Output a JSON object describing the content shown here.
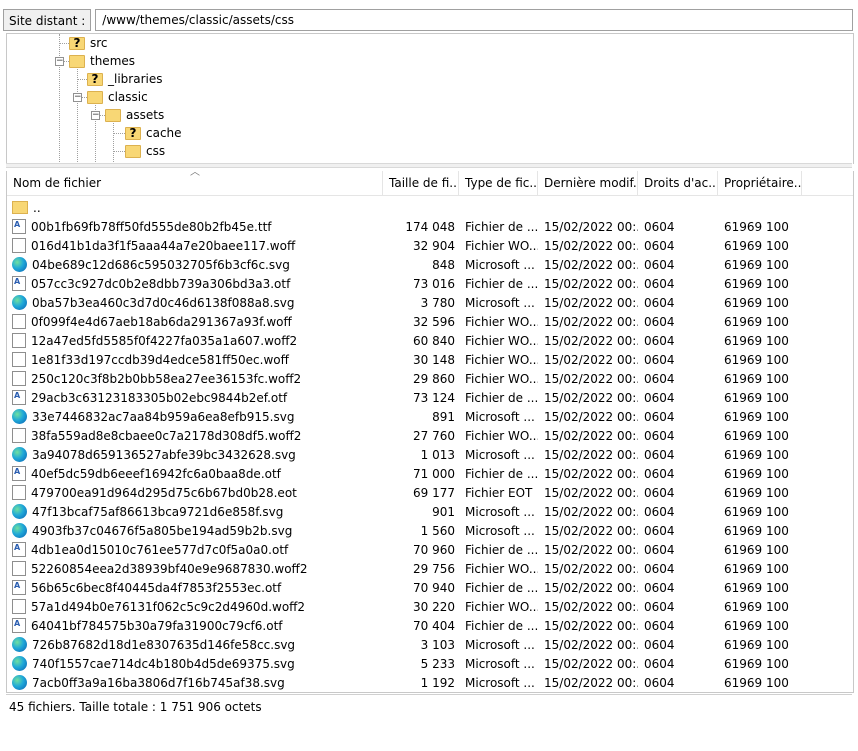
{
  "remote_site": {
    "label": "Site distant :",
    "path": "/www/themes/classic/assets/css"
  },
  "tree": {
    "items": [
      {
        "label": "src",
        "icon": "unknown-folder-icon"
      },
      {
        "label": "themes",
        "icon": "folder-icon"
      },
      {
        "label": "_libraries",
        "icon": "unknown-folder-icon"
      },
      {
        "label": "classic",
        "icon": "folder-icon"
      },
      {
        "label": "assets",
        "icon": "folder-icon"
      },
      {
        "label": "cache",
        "icon": "unknown-folder-icon"
      },
      {
        "label": "css",
        "icon": "folder-icon"
      }
    ]
  },
  "columns": {
    "name": "Nom de fichier",
    "size": "Taille de fi...",
    "type": "Type de fic...",
    "date": "Dernière modif...",
    "perm": "Droits d'ac...",
    "owner": "Propriétaire..."
  },
  "parent_row": {
    "name": ".."
  },
  "files": [
    {
      "name": "00b1fb69fb78ff50fd555de80b2fb45e.ttf",
      "size": "174 048",
      "type": "Fichier de ...",
      "date": "15/02/2022 00:...",
      "perm": "0604",
      "owner": "61969 100",
      "icon": "font-file-icon"
    },
    {
      "name": "016d41b1da3f1f5aaa44a7e20baee117.woff",
      "size": "32 904",
      "type": "Fichier WO...",
      "date": "15/02/2022 00:...",
      "perm": "0604",
      "owner": "61969 100",
      "icon": "file-icon"
    },
    {
      "name": "04be689c12d686c595032705f6b3cf6c.svg",
      "size": "848",
      "type": "Microsoft ...",
      "date": "15/02/2022 00:...",
      "perm": "0604",
      "owner": "61969 100",
      "icon": "edge-icon"
    },
    {
      "name": "057cc3c927dc0b2e8dbb739a306bd3a3.otf",
      "size": "73 016",
      "type": "Fichier de ...",
      "date": "15/02/2022 00:...",
      "perm": "0604",
      "owner": "61969 100",
      "icon": "font-file-icon"
    },
    {
      "name": "0ba57b3ea460c3d7d0c46d6138f088a8.svg",
      "size": "3 780",
      "type": "Microsoft ...",
      "date": "15/02/2022 00:...",
      "perm": "0604",
      "owner": "61969 100",
      "icon": "edge-icon"
    },
    {
      "name": "0f099f4e4d67aeb18ab6da291367a93f.woff",
      "size": "32 596",
      "type": "Fichier WO...",
      "date": "15/02/2022 00:...",
      "perm": "0604",
      "owner": "61969 100",
      "icon": "file-icon"
    },
    {
      "name": "12a47ed5fd5585f0f4227fa035a1a607.woff2",
      "size": "60 840",
      "type": "Fichier WO...",
      "date": "15/02/2022 00:...",
      "perm": "0604",
      "owner": "61969 100",
      "icon": "file-icon"
    },
    {
      "name": "1e81f33d197ccdb39d4edce581ff50ec.woff",
      "size": "30 148",
      "type": "Fichier WO...",
      "date": "15/02/2022 00:...",
      "perm": "0604",
      "owner": "61969 100",
      "icon": "file-icon"
    },
    {
      "name": "250c120c3f8b2b0bb58ea27ee36153fc.woff2",
      "size": "29 860",
      "type": "Fichier WO...",
      "date": "15/02/2022 00:...",
      "perm": "0604",
      "owner": "61969 100",
      "icon": "file-icon"
    },
    {
      "name": "29acb3c63123183305b02ebc9844b2ef.otf",
      "size": "73 124",
      "type": "Fichier de ...",
      "date": "15/02/2022 00:...",
      "perm": "0604",
      "owner": "61969 100",
      "icon": "font-file-icon"
    },
    {
      "name": "33e7446832ac7aa84b959a6ea8efb915.svg",
      "size": "891",
      "type": "Microsoft ...",
      "date": "15/02/2022 00:...",
      "perm": "0604",
      "owner": "61969 100",
      "icon": "edge-icon"
    },
    {
      "name": "38fa559ad8e8cbaee0c7a2178d308df5.woff2",
      "size": "27 760",
      "type": "Fichier WO...",
      "date": "15/02/2022 00:...",
      "perm": "0604",
      "owner": "61969 100",
      "icon": "file-icon"
    },
    {
      "name": "3a94078d659136527abfe39bc3432628.svg",
      "size": "1 013",
      "type": "Microsoft ...",
      "date": "15/02/2022 00:...",
      "perm": "0604",
      "owner": "61969 100",
      "icon": "edge-icon"
    },
    {
      "name": "40ef5dc59db6eeef16942fc6a0baa8de.otf",
      "size": "71 000",
      "type": "Fichier de ...",
      "date": "15/02/2022 00:...",
      "perm": "0604",
      "owner": "61969 100",
      "icon": "font-file-icon"
    },
    {
      "name": "479700ea91d964d295d75c6b67bd0b28.eot",
      "size": "69 177",
      "type": "Fichier EOT",
      "date": "15/02/2022 00:...",
      "perm": "0604",
      "owner": "61969 100",
      "icon": "file-icon"
    },
    {
      "name": "47f13bcaf75af86613bca9721d6e858f.svg",
      "size": "901",
      "type": "Microsoft ...",
      "date": "15/02/2022 00:...",
      "perm": "0604",
      "owner": "61969 100",
      "icon": "edge-icon"
    },
    {
      "name": "4903fb37c04676f5a805be194ad59b2b.svg",
      "size": "1 560",
      "type": "Microsoft ...",
      "date": "15/02/2022 00:...",
      "perm": "0604",
      "owner": "61969 100",
      "icon": "edge-icon"
    },
    {
      "name": "4db1ea0d15010c761ee577d7c0f5a0a0.otf",
      "size": "70 960",
      "type": "Fichier de ...",
      "date": "15/02/2022 00:...",
      "perm": "0604",
      "owner": "61969 100",
      "icon": "font-file-icon"
    },
    {
      "name": "52260854eea2d38939bf40e9e9687830.woff2",
      "size": "29 756",
      "type": "Fichier WO...",
      "date": "15/02/2022 00:...",
      "perm": "0604",
      "owner": "61969 100",
      "icon": "file-icon"
    },
    {
      "name": "56b65c6bec8f40445da4f7853f2553ec.otf",
      "size": "70 940",
      "type": "Fichier de ...",
      "date": "15/02/2022 00:...",
      "perm": "0604",
      "owner": "61969 100",
      "icon": "font-file-icon"
    },
    {
      "name": "57a1d494b0e76131f062c5c9c2d4960d.woff2",
      "size": "30 220",
      "type": "Fichier WO...",
      "date": "15/02/2022 00:...",
      "perm": "0604",
      "owner": "61969 100",
      "icon": "file-icon"
    },
    {
      "name": "64041bf784575b30a79fa31900c79cf6.otf",
      "size": "70 404",
      "type": "Fichier de ...",
      "date": "15/02/2022 00:...",
      "perm": "0604",
      "owner": "61969 100",
      "icon": "font-file-icon"
    },
    {
      "name": "726b87682d18d1e8307635d146fe58cc.svg",
      "size": "3 103",
      "type": "Microsoft ...",
      "date": "15/02/2022 00:...",
      "perm": "0604",
      "owner": "61969 100",
      "icon": "edge-icon"
    },
    {
      "name": "740f1557cae714dc4b180b4d5de69375.svg",
      "size": "5 233",
      "type": "Microsoft ...",
      "date": "15/02/2022 00:...",
      "perm": "0604",
      "owner": "61969 100",
      "icon": "edge-icon"
    },
    {
      "name": "7acb0ff3a9a16ba3806d7f16b745af38.svg",
      "size": "1 192",
      "type": "Microsoft ...",
      "date": "15/02/2022 00:...",
      "perm": "0604",
      "owner": "61969 100",
      "icon": "edge-icon"
    }
  ],
  "status": {
    "text": "45 fichiers. Taille totale : 1 751 906 octets"
  }
}
